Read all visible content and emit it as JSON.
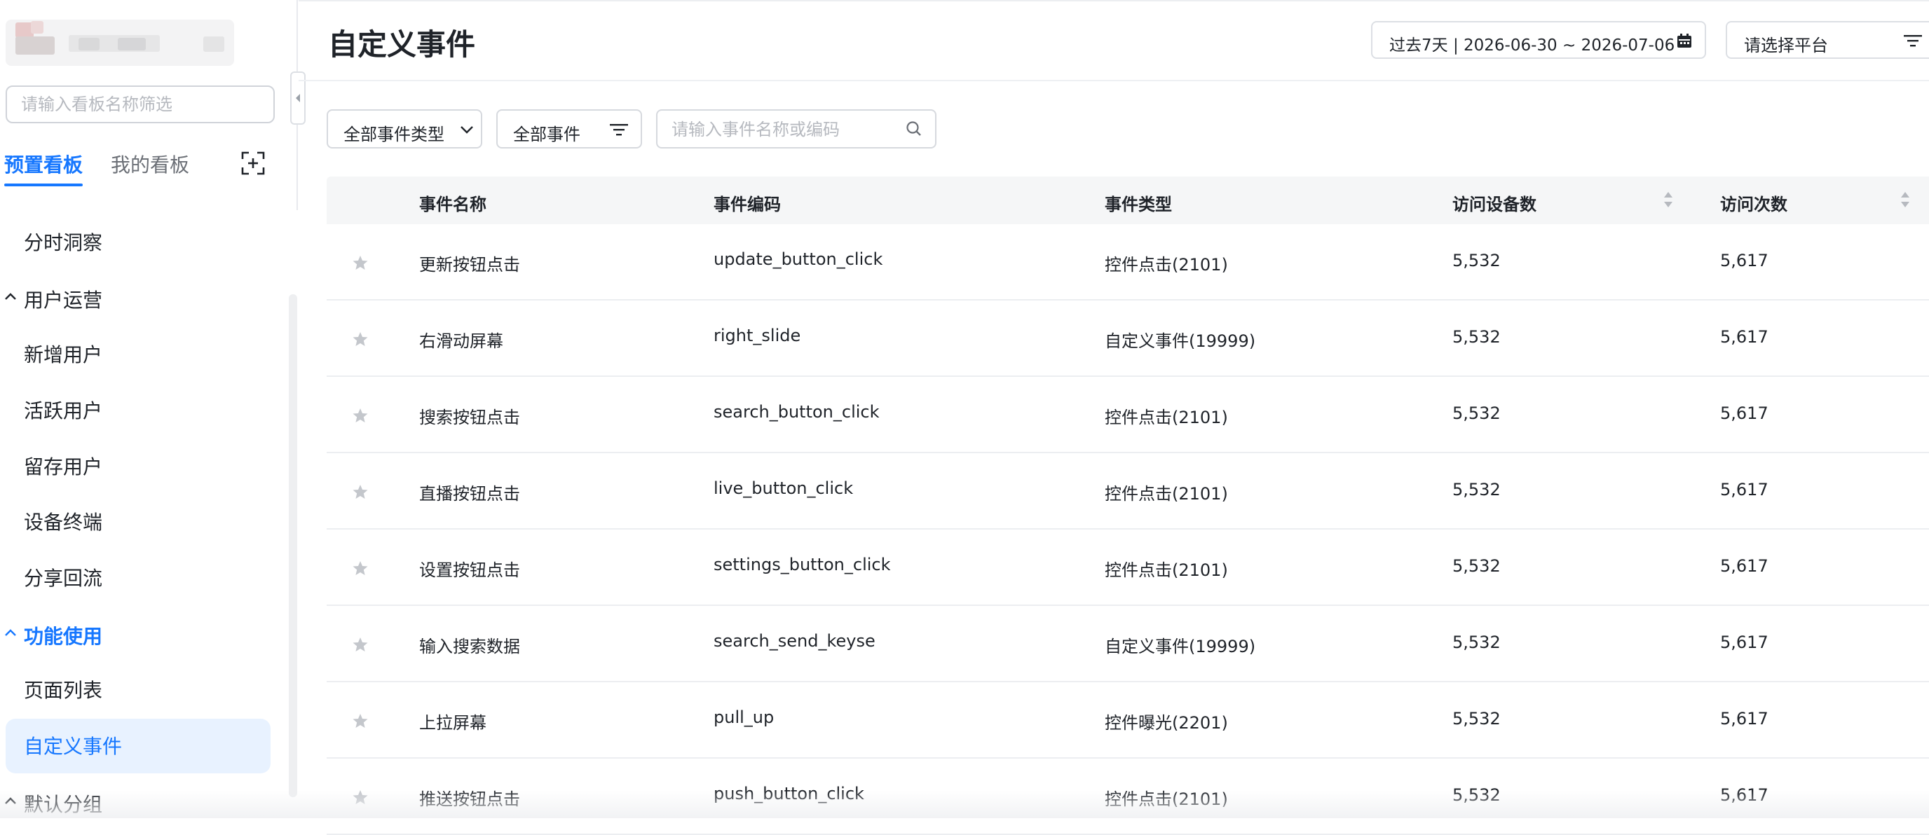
{
  "colors": {
    "accent": "#1677ff",
    "active_bg": "#e8f2ff",
    "star": "#c4c7cc",
    "text": "#1f2329",
    "muted": "#b6b9bf"
  },
  "sidebar": {
    "search_placeholder": "请输入看板名称筛选",
    "tabs": [
      {
        "label": "预置看板",
        "active": true
      },
      {
        "label": "我的看板",
        "active": false
      }
    ],
    "items": [
      {
        "label": "分时洞察",
        "kind": "item"
      },
      {
        "label": "用户运营",
        "kind": "group"
      },
      {
        "label": "新增用户",
        "kind": "item"
      },
      {
        "label": "活跃用户",
        "kind": "item"
      },
      {
        "label": "留存用户",
        "kind": "item"
      },
      {
        "label": "设备终端",
        "kind": "item"
      },
      {
        "label": "分享回流",
        "kind": "item"
      },
      {
        "label": "功能使用",
        "kind": "group",
        "highlight": true
      },
      {
        "label": "页面列表",
        "kind": "item"
      },
      {
        "label": "自定义事件",
        "kind": "item",
        "active": true
      },
      {
        "label": "默认分组",
        "kind": "group"
      }
    ]
  },
  "header": {
    "title": "自定义事件",
    "date_range": "过去7天 | 2026-06-30 ~ 2026-07-06",
    "platform_placeholder": "请选择平台"
  },
  "filters": {
    "event_type": "全部事件类型",
    "event_scope": "全部事件",
    "search_placeholder": "请输入事件名称或编码"
  },
  "table": {
    "columns": [
      "事件名称",
      "事件编码",
      "事件类型",
      "访问设备数",
      "访问次数"
    ],
    "rows": [
      {
        "name": "更新按钮点击",
        "code": "update_button_click",
        "type": "控件点击(2101)",
        "devices": "5,532",
        "visits": "5,617"
      },
      {
        "name": "右滑动屏幕",
        "code": "right_slide",
        "type": "自定义事件(19999)",
        "devices": "5,532",
        "visits": "5,617"
      },
      {
        "name": "搜索按钮点击",
        "code": "search_button_click",
        "type": "控件点击(2101)",
        "devices": "5,532",
        "visits": "5,617"
      },
      {
        "name": "直播按钮点击",
        "code": "live_button_click",
        "type": "控件点击(2101)",
        "devices": "5,532",
        "visits": "5,617"
      },
      {
        "name": "设置按钮点击",
        "code": "settings_button_click",
        "type": "控件点击(2101)",
        "devices": "5,532",
        "visits": "5,617"
      },
      {
        "name": "输入搜索数据",
        "code": "search_send_keyse",
        "type": "自定义事件(19999)",
        "devices": "5,532",
        "visits": "5,617"
      },
      {
        "name": "上拉屏幕",
        "code": "pull_up",
        "type": "控件曝光(2201)",
        "devices": "5,532",
        "visits": "5,617"
      },
      {
        "name": "推送按钮点击",
        "code": "push_button_click",
        "type": "控件点击(2101)",
        "devices": "5,532",
        "visits": "5,617"
      }
    ]
  }
}
